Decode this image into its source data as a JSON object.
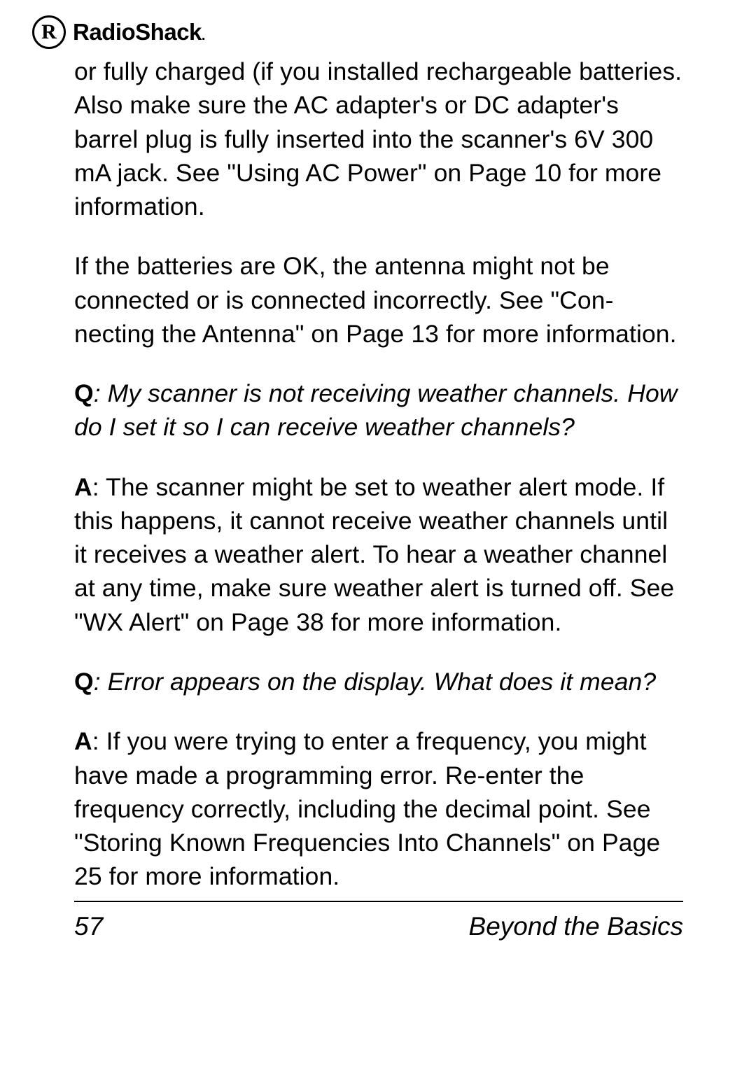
{
  "header": {
    "logo_letter": "R",
    "brand": "RadioShack",
    "brand_suffix": "."
  },
  "body": {
    "p1": "or fully charged (if you installed rechargeable batteries. Also make sure the AC adapter's or DC adapter's barrel plug is fully inserted into the scanner's 6V 300 mA jack. See \"Using AC Power\" on Page 10 for more information.",
    "p2": "If the batteries are OK, the antenna might not be connected or is connected incorrectly. See \"Con-necting the Antenna\" on Page 13 for more information.",
    "q1_label": "Q",
    "q1_text": ": My scanner is not receiving weather channels. How do I set it so I can receive weather channels?",
    "a1_label": "A",
    "a1_text": ": The scanner might be set to weather alert mode. If this happens, it cannot receive weather channels until it receives a weather alert. To hear a weather channel at any time, make sure weather alert is turned off. See \"WX Alert\" on Page 38 for more information.",
    "q2_label": "Q",
    "q2_text": ": Error appears on the display. What does it mean?",
    "a2_label": "A",
    "a2_text": ": If you were trying to enter a frequency, you might have made a programming error. Re-enter the frequency correctly, including the decimal point. See \"Storing Known Frequencies Into Channels\" on Page 25 for more information."
  },
  "footer": {
    "page_number": "57",
    "section": "Beyond the Basics"
  }
}
